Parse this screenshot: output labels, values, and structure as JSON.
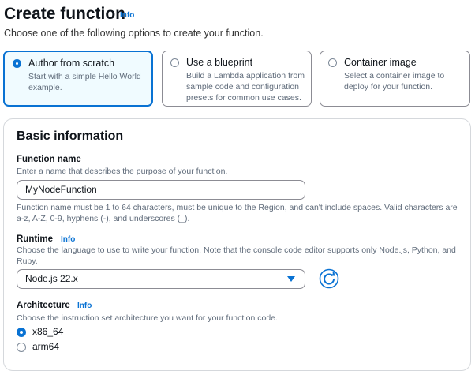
{
  "header": {
    "title": "Create function",
    "info": "Info",
    "subtitle": "Choose one of the following options to create your function."
  },
  "options": [
    {
      "title": "Author from scratch",
      "desc": "Start with a simple Hello World example.",
      "selected": true
    },
    {
      "title": "Use a blueprint",
      "desc": "Build a Lambda application from sample code and configuration presets for common use cases.",
      "selected": false
    },
    {
      "title": "Container image",
      "desc": "Select a container image to deploy for your function.",
      "selected": false
    }
  ],
  "basic": {
    "heading": "Basic information",
    "function_name": {
      "label": "Function name",
      "desc": "Enter a name that describes the purpose of your function.",
      "value": "MyNodeFunction",
      "help": "Function name must be 1 to 64 characters, must be unique to the Region, and can't include spaces. Valid characters are a-z, A-Z, 0-9, hyphens (-), and underscores (_)."
    },
    "runtime": {
      "label": "Runtime",
      "info": "Info",
      "desc": "Choose the language to use to write your function. Note that the console code editor supports only Node.js, Python, and Ruby.",
      "value": "Node.js 22.x",
      "refresh_icon": "refresh-icon"
    },
    "architecture": {
      "label": "Architecture",
      "info": "Info",
      "desc": "Choose the instruction set architecture you want for your function code.",
      "options": [
        {
          "label": "x86_64",
          "selected": true
        },
        {
          "label": "arm64",
          "selected": false
        }
      ]
    }
  },
  "colors": {
    "accent": "#0972d3",
    "selected_bg": "#f0fbff"
  }
}
